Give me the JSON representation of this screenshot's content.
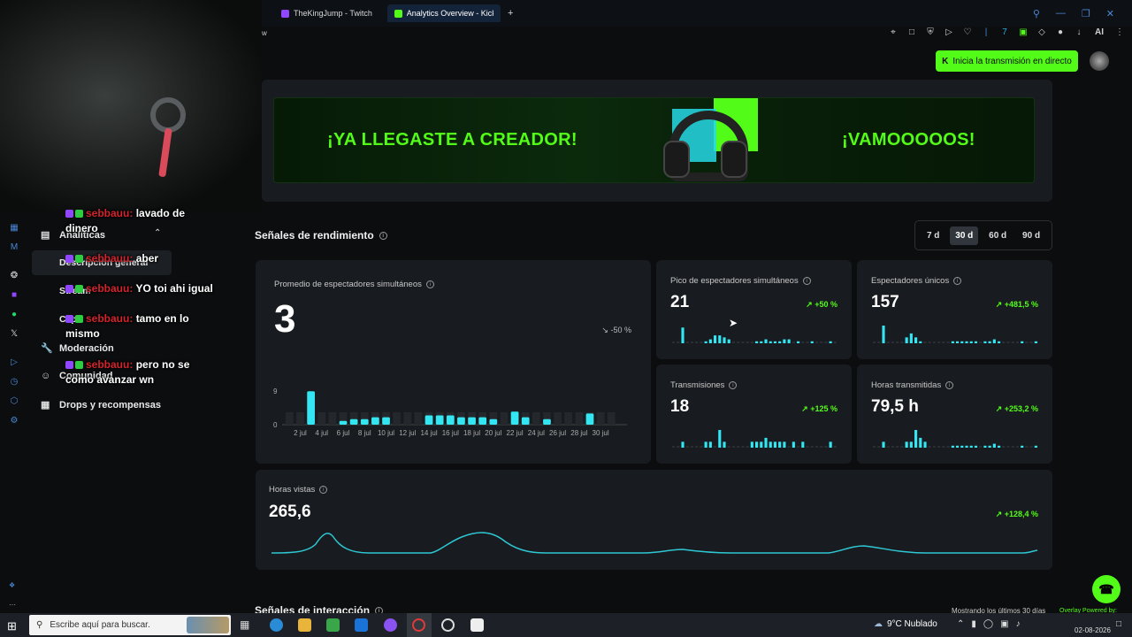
{
  "browser": {
    "tabs": [
      {
        "label": "TheKingJump - Twitch",
        "color": "#9146ff"
      },
      {
        "label": "Analytics Overview - Kick",
        "color": "#53fc18"
      }
    ],
    "new_tab": "+",
    "url_fragment": "w",
    "toolbar_ai": "AI"
  },
  "sidebar": {
    "items": [
      {
        "label": "Analíticas",
        "icon": "chart-icon"
      },
      {
        "label": "Descripción general"
      },
      {
        "label": "Stream"
      },
      {
        "label": "Clips"
      },
      {
        "label": "Moderación",
        "icon": "wrench-icon"
      },
      {
        "label": "Comunidad",
        "icon": "users-icon"
      },
      {
        "label": "Drops y recompensas",
        "icon": "gift-icon"
      }
    ]
  },
  "chat": [
    {
      "user": "sebbauu:",
      "message": "lavado de dinero"
    },
    {
      "user": "sebbauu:",
      "message": "aber"
    },
    {
      "user": "sebbauu:",
      "message": "YO toi ahi igual"
    },
    {
      "user": "sebbauu:",
      "message": "tamo en lo mismo"
    },
    {
      "user": "sebbauu:",
      "message": "pero no se como avanzar wn"
    }
  ],
  "header": {
    "live_button": "Inicia la transmisión en directo"
  },
  "banner": {
    "left_text": "¡YA LLEGASTE A CREADOR!",
    "right_text": "¡VAMOOOOOS!"
  },
  "performance": {
    "title": "Señales de rendimiento",
    "ranges": [
      "7 d",
      "30 d",
      "60 d",
      "90 d"
    ],
    "selected_range": "30 d",
    "avg_viewers": {
      "label": "Promedio de espectadores simultáneos",
      "value": "3",
      "change": "-50 %"
    },
    "peak_viewers": {
      "label": "Pico de espectadores simultáneos",
      "value": "21",
      "change": "+50 %"
    },
    "unique_viewers": {
      "label": "Espectadores únicos",
      "value": "157",
      "change": "+481,5 %"
    },
    "streams": {
      "label": "Transmisiones",
      "value": "18",
      "change": "+125 %"
    },
    "hours_streamed": {
      "label": "Horas transmitidas",
      "value": "79,5 h",
      "change": "+253,2 %"
    },
    "hours_watched": {
      "label": "Horas vistas",
      "value": "265,6",
      "change": "+128,4 %"
    }
  },
  "chart_data": {
    "type": "bar",
    "categories": [
      "1 jul",
      "2 jul",
      "3 jul",
      "4 jul",
      "5 jul",
      "6 jul",
      "7 jul",
      "8 jul",
      "9 jul",
      "10 jul",
      "11 jul",
      "12 jul",
      "13 jul",
      "14 jul",
      "15 jul",
      "16 jul",
      "17 jul",
      "18 jul",
      "19 jul",
      "20 jul",
      "21 jul",
      "22 jul",
      "23 jul",
      "24 jul",
      "25 jul",
      "26 jul",
      "27 jul",
      "28 jul",
      "29 jul",
      "30 jul",
      "31 jul"
    ],
    "tick_labels": [
      "2 jul",
      "4 jul",
      "6 jul",
      "8 jul",
      "10 jul",
      "12 jul",
      "14 jul",
      "16 jul",
      "18 jul",
      "20 jul",
      "22 jul",
      "24 jul",
      "26 jul",
      "28 jul",
      "30 jul"
    ],
    "values": [
      0,
      0,
      9,
      0,
      0,
      1,
      1.5,
      1.5,
      2,
      2,
      0,
      0,
      0,
      2.5,
      2.5,
      2.5,
      2,
      2,
      2,
      1.5,
      0,
      3.5,
      2,
      0,
      1.5,
      0,
      0,
      0,
      3,
      0,
      0
    ],
    "y_ticks": [
      "0",
      "9"
    ],
    "ylim": [
      0,
      10
    ],
    "accent": "#33e6f2"
  },
  "interaction": {
    "title": "Señales de interacción",
    "note": "Mostrando los últimos 30 días"
  },
  "taskbar": {
    "search_placeholder": "Escribe aquí para buscar.",
    "weather": "9°C  Nublado",
    "clock_date": "02-08-2026",
    "overlay_text": "Overlay Powered by:"
  }
}
